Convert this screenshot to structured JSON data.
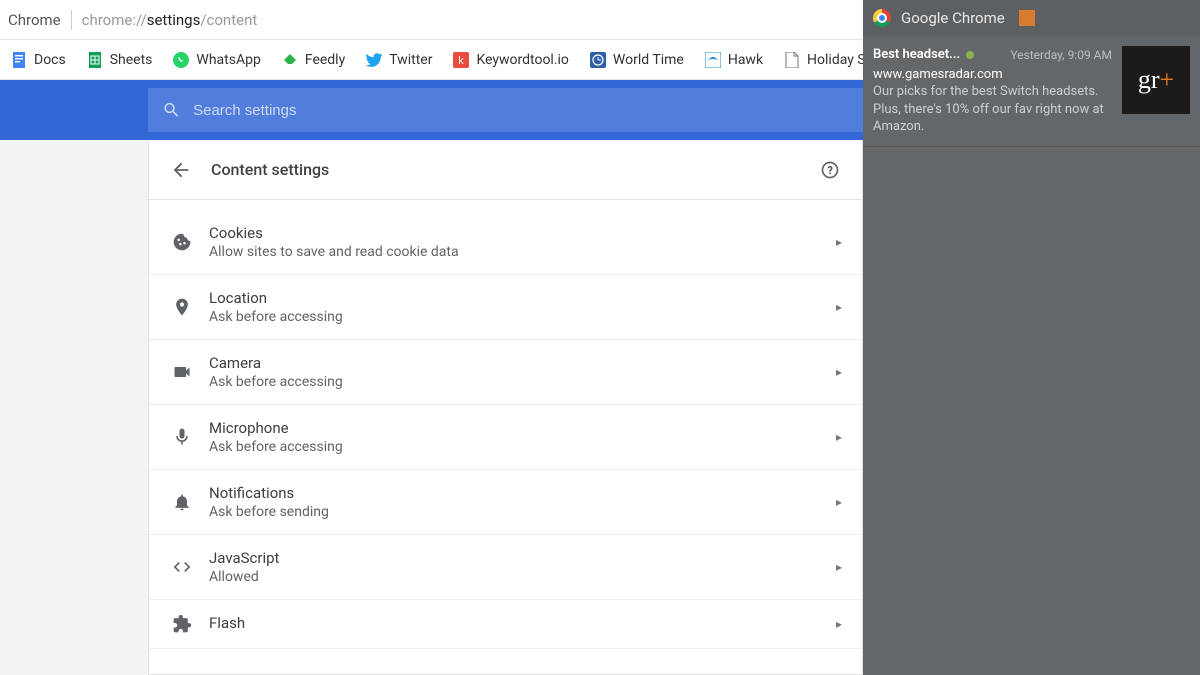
{
  "locbar": {
    "app": "Chrome",
    "url_pre": "chrome://",
    "url_bold": "settings",
    "url_post": "/content"
  },
  "bookmarks": [
    {
      "label": "Docs",
      "icon": "docs"
    },
    {
      "label": "Sheets",
      "icon": "sheets"
    },
    {
      "label": "WhatsApp",
      "icon": "whatsapp"
    },
    {
      "label": "Feedly",
      "icon": "feedly"
    },
    {
      "label": "Twitter",
      "icon": "twitter"
    },
    {
      "label": "Keywordtool.io",
      "icon": "keywordtool"
    },
    {
      "label": "World Time",
      "icon": "worldtime"
    },
    {
      "label": "Hawk",
      "icon": "hawk"
    },
    {
      "label": "Holiday Syst",
      "icon": "page"
    }
  ],
  "search": {
    "placeholder": "Search settings"
  },
  "page": {
    "title": "Content settings"
  },
  "settings": [
    {
      "title": "Cookies",
      "subtitle": "Allow sites to save and read cookie data",
      "icon": "cookie"
    },
    {
      "title": "Location",
      "subtitle": "Ask before accessing",
      "icon": "location"
    },
    {
      "title": "Camera",
      "subtitle": "Ask before accessing",
      "icon": "camera"
    },
    {
      "title": "Microphone",
      "subtitle": "Ask before accessing",
      "icon": "mic"
    },
    {
      "title": "Notifications",
      "subtitle": "Ask before sending",
      "icon": "bell"
    },
    {
      "title": "JavaScript",
      "subtitle": "Allowed",
      "icon": "code"
    },
    {
      "title": "Flash",
      "subtitle": "",
      "icon": "plugin"
    }
  ],
  "drawer": {
    "app": "Google Chrome",
    "notification": {
      "title": "Best headset...",
      "time": "Yesterday, 9:09 AM",
      "site": "www.gamesradar.com",
      "body": "Our picks for the best Switch headsets. Plus, there's 10% off our fav right now at Amazon.",
      "thumb": "gr+"
    }
  }
}
